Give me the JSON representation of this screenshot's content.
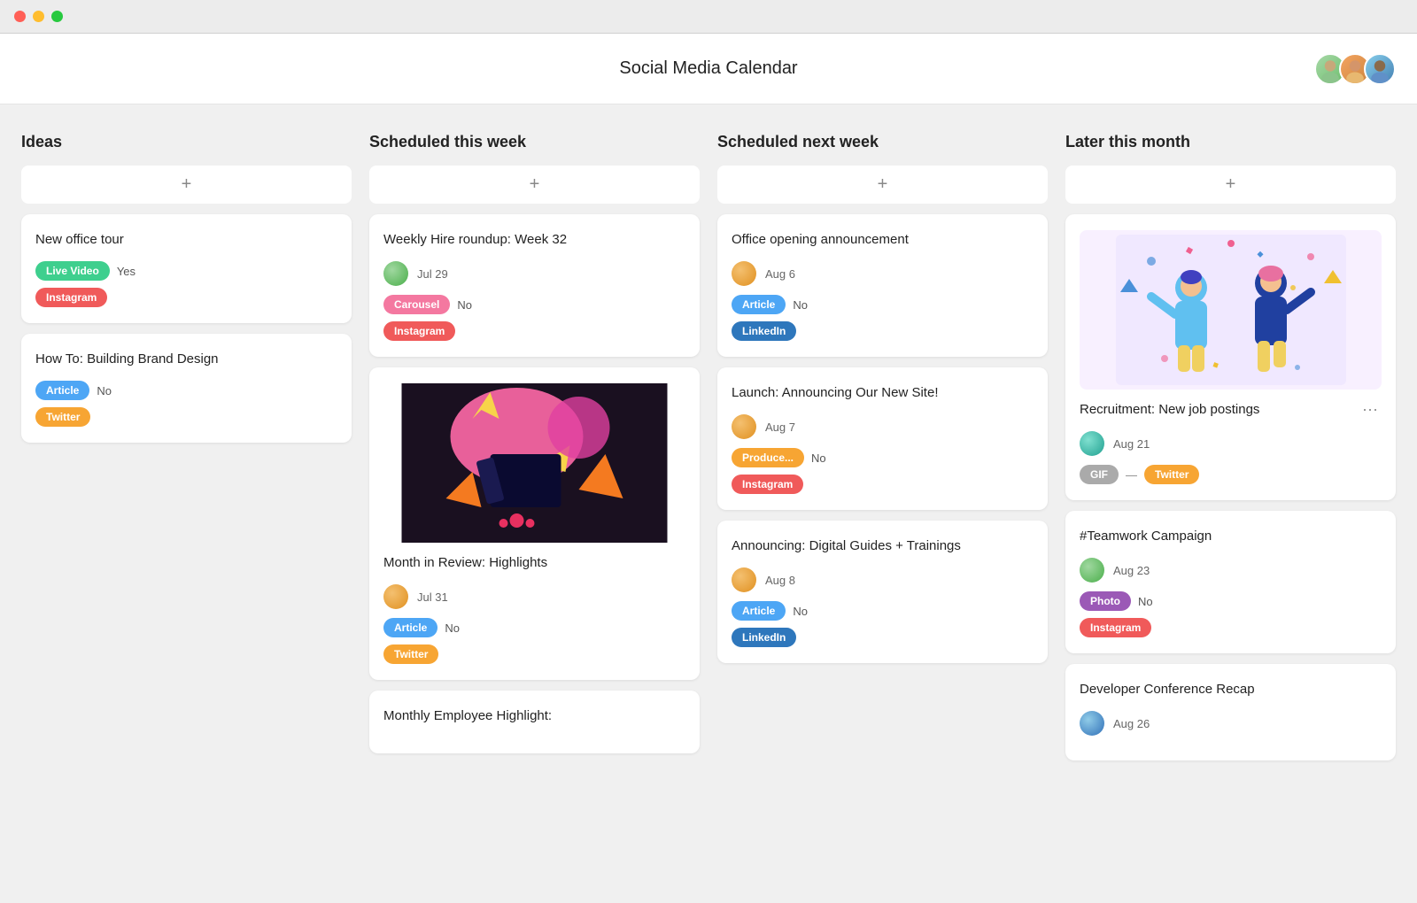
{
  "app": {
    "title": "Social Media Calendar"
  },
  "header": {
    "avatars": [
      "av1",
      "av2",
      "av3"
    ]
  },
  "columns": [
    {
      "id": "ideas",
      "label": "Ideas",
      "add_label": "+",
      "cards": [
        {
          "id": "card-1",
          "title": "New office tour",
          "badge1": "Live Video",
          "badge1_color": "badge-green",
          "value1": "Yes",
          "badge2": "Instagram",
          "badge2_color": "badge-red",
          "has_avatar": false,
          "date": ""
        },
        {
          "id": "card-2",
          "title": "How To: Building Brand Design",
          "badge1": "Article",
          "badge1_color": "badge-blue",
          "value1": "No",
          "badge2": "Twitter",
          "badge2_color": "badge-orange",
          "has_avatar": false,
          "date": ""
        }
      ]
    },
    {
      "id": "scheduled-this-week",
      "label": "Scheduled this week",
      "add_label": "+",
      "cards": [
        {
          "id": "card-3",
          "title": "Weekly Hire roundup: Week 32",
          "avatar_class": "av-green",
          "date": "Jul 29",
          "badge1": "Carousel",
          "badge1_color": "badge-pink",
          "value1": "No",
          "badge2": "Instagram",
          "badge2_color": "badge-red",
          "has_image": false,
          "has_art": false
        },
        {
          "id": "card-4",
          "title": "",
          "has_image": true,
          "image_type": "colorful-art",
          "sub_title": "Month in Review: Highlights",
          "avatar_class": "av-orange",
          "date": "Jul 31",
          "badge1": "Article",
          "badge1_color": "badge-blue",
          "value1": "No",
          "badge2": "Twitter",
          "badge2_color": "badge-orange"
        },
        {
          "id": "card-5",
          "title": "Monthly Employee Highlight:",
          "has_partial": true
        }
      ]
    },
    {
      "id": "scheduled-next-week",
      "label": "Scheduled next week",
      "add_label": "+",
      "cards": [
        {
          "id": "card-6",
          "title": "Office opening announcement",
          "avatar_class": "av-orange",
          "date": "Aug 6",
          "badge1": "Article",
          "badge1_color": "badge-blue",
          "value1": "No",
          "badge2": "LinkedIn",
          "badge2_color": "badge-linkedin"
        },
        {
          "id": "card-7",
          "title": "Launch: Announcing Our New Site!",
          "avatar_class": "av-orange",
          "date": "Aug 7",
          "badge1": "Produce...",
          "badge1_color": "badge-orange",
          "value1": "No",
          "badge2": "Instagram",
          "badge2_color": "badge-red"
        },
        {
          "id": "card-8",
          "title": "Announcing: Digital Guides + Trainings",
          "avatar_class": "av-orange",
          "date": "Aug 8",
          "badge1": "Article",
          "badge1_color": "badge-blue",
          "value1": "No",
          "badge2": "LinkedIn",
          "badge2_color": "badge-linkedin"
        }
      ]
    },
    {
      "id": "later-this-month",
      "label": "Later this month",
      "add_label": "+",
      "cards": [
        {
          "id": "card-9",
          "title": "Recruitment: New job postings",
          "has_illustration": true,
          "avatar_class": "av-teal",
          "date": "Aug 21",
          "badge1": "GIF",
          "badge1_color": "badge-gray",
          "badge2": "Twitter",
          "badge2_color": "badge-orange",
          "has_more": true
        },
        {
          "id": "card-10",
          "title": "#Teamwork Campaign",
          "avatar_class": "av-green",
          "date": "Aug 23",
          "badge1": "Photo",
          "badge1_color": "badge-purple",
          "value1": "No",
          "badge2": "Instagram",
          "badge2_color": "badge-red"
        },
        {
          "id": "card-11",
          "title": "Developer Conference Recap",
          "avatar_class": "av-blue",
          "date": "Aug 26",
          "partial": true
        }
      ]
    }
  ]
}
